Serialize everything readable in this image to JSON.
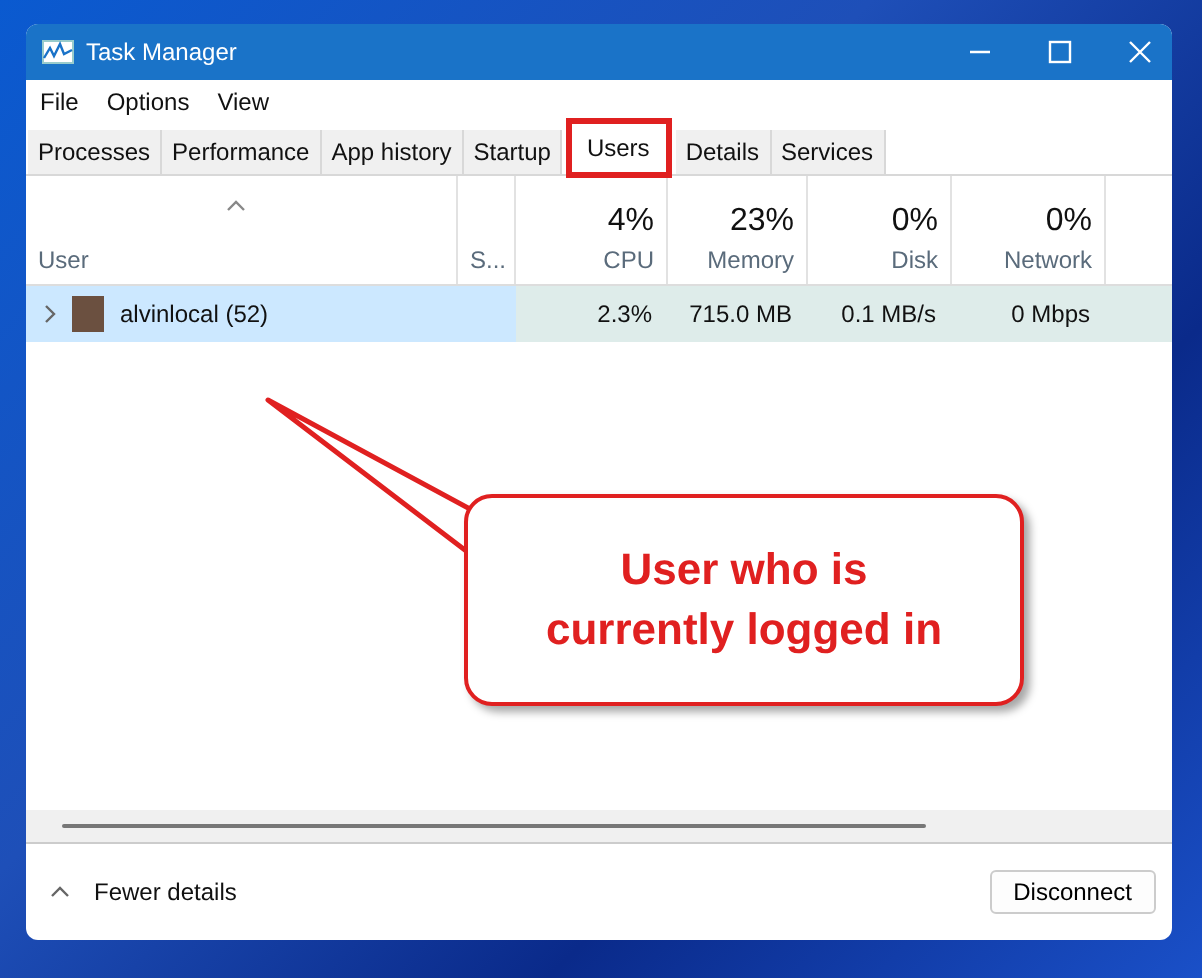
{
  "window": {
    "title": "Task Manager"
  },
  "menu": [
    "File",
    "Options",
    "View"
  ],
  "tabs": [
    {
      "label": "Processes",
      "selected": false
    },
    {
      "label": "Performance",
      "selected": false
    },
    {
      "label": "App history",
      "selected": false
    },
    {
      "label": "Startup",
      "selected": false
    },
    {
      "label": "Users",
      "selected": true
    },
    {
      "label": "Details",
      "selected": false
    },
    {
      "label": "Services",
      "selected": false
    }
  ],
  "table": {
    "columns": [
      {
        "label": "User",
        "sorted": true
      },
      {
        "label": "S...",
        "sorted": false
      },
      {
        "label": "CPU",
        "usage": "4%",
        "sorted": false
      },
      {
        "label": "Memory",
        "usage": "23%",
        "sorted": false
      },
      {
        "label": "Disk",
        "usage": "0%",
        "sorted": false
      },
      {
        "label": "Network",
        "usage": "0%",
        "sorted": false
      }
    ],
    "rows": [
      {
        "expanded": false,
        "selected": true,
        "cells": [
          "alvinlocal (52)",
          "",
          "2.3%",
          "715.0 MB",
          "0.1 MB/s",
          "0 Mbps"
        ]
      }
    ]
  },
  "footer": {
    "toggle": "Fewer details",
    "button": "Disconnect"
  },
  "annotation": {
    "lines": [
      "User who is",
      "currently logged in"
    ]
  }
}
